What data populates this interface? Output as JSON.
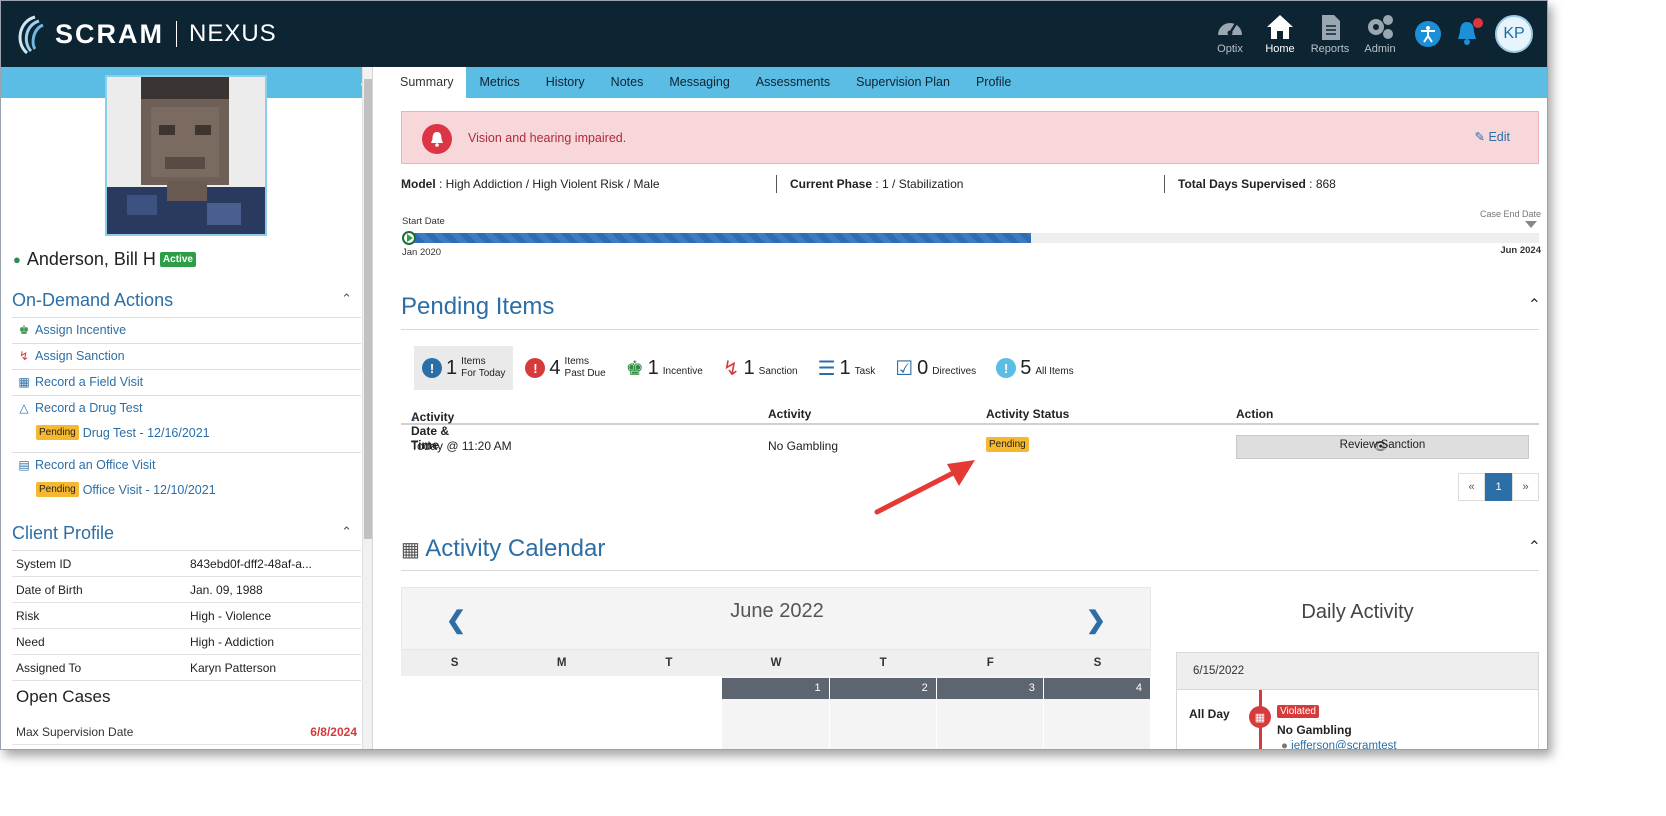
{
  "brand": {
    "name": "SCRAM",
    "product": "NEXUS"
  },
  "nav": {
    "items": [
      {
        "label": "Optix",
        "icon": "gauge-icon"
      },
      {
        "label": "Home",
        "icon": "home-icon"
      },
      {
        "label": "Reports",
        "icon": "report-icon"
      },
      {
        "label": "Admin",
        "icon": "gears-icon"
      }
    ],
    "avatar": "KP"
  },
  "client": {
    "name": "Anderson, Bill H",
    "status": "Active"
  },
  "on_demand": {
    "title": "On-Demand Actions",
    "actions": [
      {
        "label": "Assign Incentive",
        "icon": "trophy-icon"
      },
      {
        "label": "Assign Sanction",
        "icon": "bolt-icon"
      },
      {
        "label": "Record a Field Visit",
        "icon": "map-icon"
      },
      {
        "label": "Record a Drug Test",
        "icon": "flask-icon"
      },
      {
        "label": "Record an Office Visit",
        "icon": "building-icon"
      }
    ],
    "pending_drug": {
      "badge": "Pending",
      "label": "Drug Test - 12/16/2021"
    },
    "pending_office": {
      "badge": "Pending",
      "label": "Office Visit - 12/10/2021"
    }
  },
  "profile": {
    "title": "Client Profile",
    "rows": [
      {
        "k": "System ID",
        "v": "843ebd0f-dff2-48af-a..."
      },
      {
        "k": "Date of Birth",
        "v": "Jan. 09, 1988"
      },
      {
        "k": "Risk",
        "v": "High - Violence"
      },
      {
        "k": "Need",
        "v": "High - Addiction"
      },
      {
        "k": "Assigned To",
        "v": "Karyn Patterson"
      }
    ],
    "open_cases": "Open Cases",
    "max_label": "Max Supervision Date",
    "max_value": "6/8/2024"
  },
  "tabs": [
    "Summary",
    "Metrics",
    "History",
    "Notes",
    "Messaging",
    "Assessments",
    "Supervision Plan",
    "Profile"
  ],
  "alert": {
    "message": "Vision and hearing impaired.",
    "edit": "Edit"
  },
  "meta": {
    "model_label": "Model",
    "model_value": " : High Addiction / High Violent Risk / Male",
    "phase_label": "Current Phase",
    "phase_value": " : 1 / Stabilization",
    "days_label": "Total Days Supervised",
    "days_value": " : 868"
  },
  "timeline": {
    "start_label": "Start Date",
    "end_label": "Case End Date",
    "start": "Jan 2020",
    "end": "Jun 2024",
    "progress": 0.55
  },
  "pending": {
    "title": "Pending Items",
    "filters": [
      {
        "num": "1",
        "l1": "Items",
        "l2": "For Today"
      },
      {
        "num": "4",
        "l1": "Items",
        "l2": "Past Due"
      },
      {
        "num": "1",
        "l1": "",
        "l2": "Incentive"
      },
      {
        "num": "1",
        "l1": "",
        "l2": "Sanction"
      },
      {
        "num": "1",
        "l1": "",
        "l2": "Task"
      },
      {
        "num": "0",
        "l1": "",
        "l2": "Directives"
      },
      {
        "num": "5",
        "l1": "",
        "l2": "All Items"
      }
    ],
    "headers": [
      "Activity Date & Time",
      "Activity",
      "Activity Status",
      "Action"
    ],
    "row": {
      "date": "Today @ 11:20 AM",
      "activity": "No Gambling",
      "status": "Pending",
      "action": "Review Sanction"
    },
    "pager": [
      "«",
      "1",
      "»"
    ]
  },
  "calendar": {
    "title": "Activity Calendar",
    "month": "June 2022",
    "dow": [
      "S",
      "M",
      "T",
      "W",
      "T",
      "F",
      "S"
    ],
    "days": [
      "",
      "",
      "",
      "1",
      "2",
      "3",
      "4"
    ]
  },
  "daily": {
    "title": "Daily Activity",
    "date": "6/15/2022",
    "all_day": "All Day",
    "badge": "Violated",
    "event": "No Gambling",
    "user": "jefferson@scramtest"
  },
  "colors": {
    "brand_dark": "#0d2433",
    "accent": "#5bbce4",
    "link": "#2c6ea6",
    "pending": "#f5b82e",
    "danger": "#d63b3b"
  }
}
